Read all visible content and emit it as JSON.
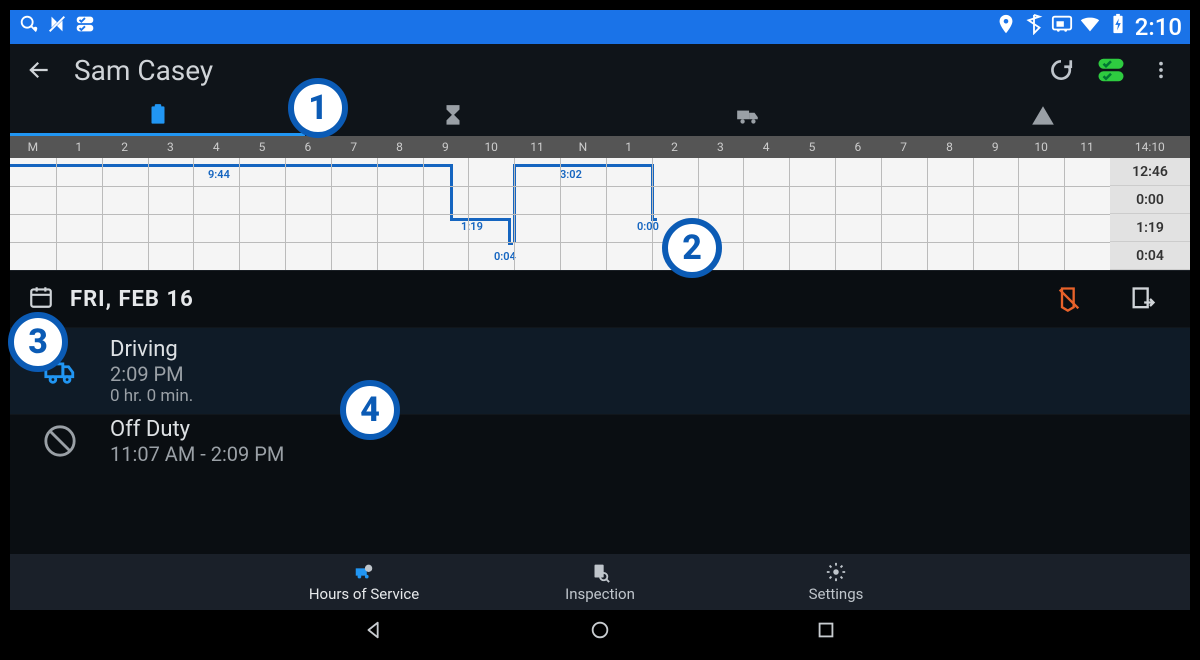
{
  "status": {
    "clock": "2:10"
  },
  "header": {
    "driver_name": "Sam Casey"
  },
  "grid": {
    "hour_labels": [
      "M",
      "1",
      "2",
      "3",
      "4",
      "5",
      "6",
      "7",
      "8",
      "9",
      "10",
      "11",
      "N",
      "1",
      "2",
      "3",
      "4",
      "5",
      "6",
      "7",
      "8",
      "9",
      "10",
      "11"
    ],
    "total_header": "14:10",
    "row_totals": [
      "12:46",
      "0:00",
      "1:19",
      "0:04"
    ],
    "segment_labels": {
      "off_duty": "9:44",
      "driving": "1:19",
      "on_duty_short": "0:04",
      "off_duty_2": "3:02",
      "zero": "0:00"
    }
  },
  "date_row": {
    "date_text": "FRI, FEB 16"
  },
  "list": {
    "items": [
      {
        "status": "Driving",
        "time": "2:09 PM",
        "duration": "0 hr. 0 min."
      },
      {
        "status": "Off Duty",
        "time": "11:07 AM - 2:09 PM",
        "duration": ""
      }
    ]
  },
  "bottom_nav": {
    "hos": "Hours of Service",
    "inspection": "Inspection",
    "settings": "Settings"
  },
  "callouts": {
    "c1": "1",
    "c2": "2",
    "c3": "3",
    "c4": "4"
  }
}
